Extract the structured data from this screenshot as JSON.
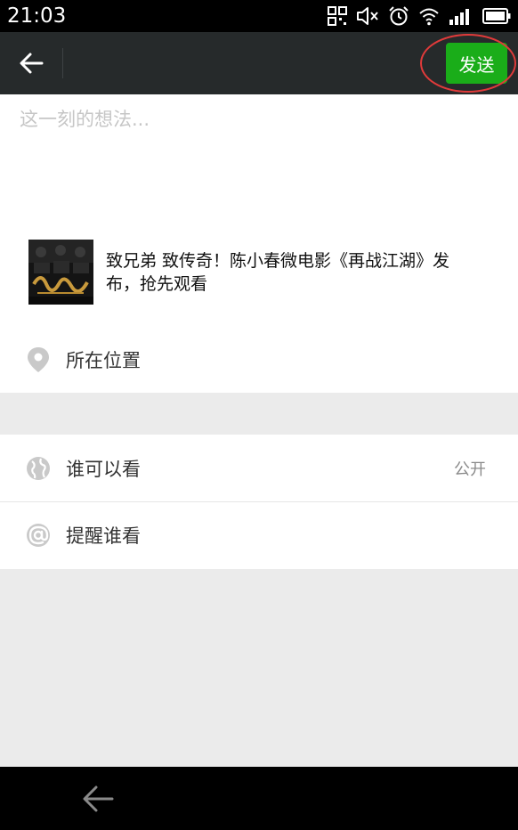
{
  "status_bar": {
    "time": "21:03"
  },
  "toolbar": {
    "send_label": "发送"
  },
  "composer": {
    "placeholder": "这一刻的想法...",
    "share": {
      "title": "致兄弟 致传奇！陈小春微电影《再战江湖》发布，抢先观看"
    },
    "location_label": "所在位置"
  },
  "settings": {
    "visibility_label": "谁可以看",
    "visibility_value": "公开",
    "mention_label": "提醒谁看"
  },
  "colors": {
    "toolbar_bg": "#262a2b",
    "send_green": "#1aad19",
    "highlight_red": "#e03a3a",
    "page_bg": "#ebebeb"
  }
}
